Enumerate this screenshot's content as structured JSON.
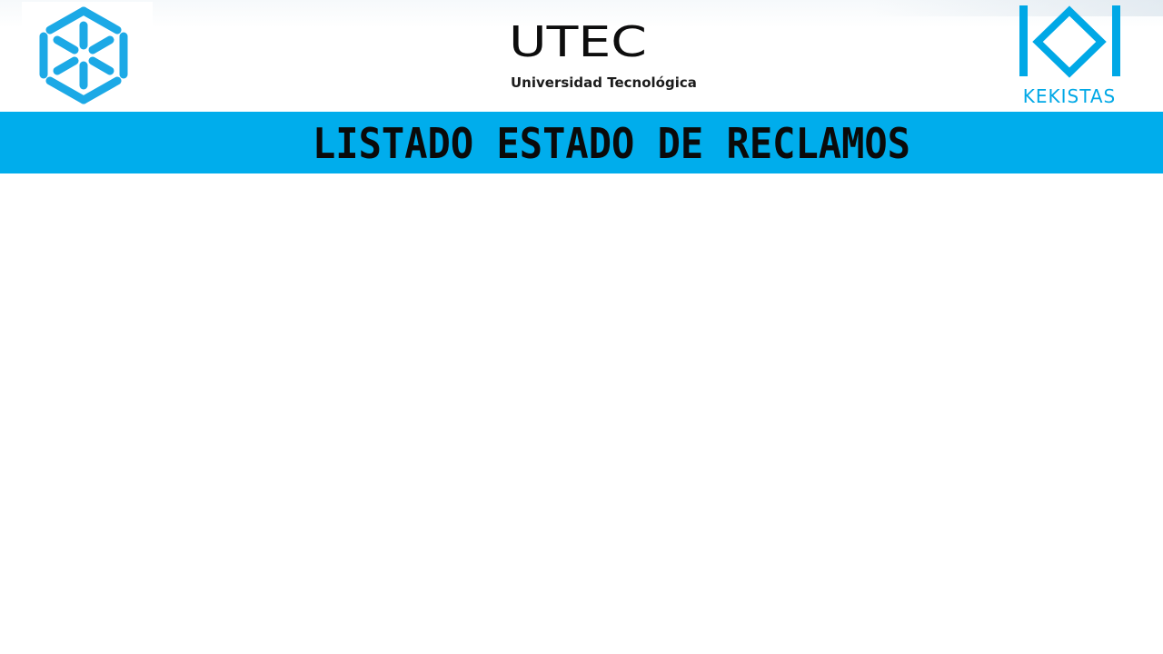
{
  "header": {
    "left_logo": {
      "icon": "hexagon-flower-logo-icon",
      "color": "#1ca9e6"
    },
    "center_logo": {
      "wordmark": "UTEC",
      "subtitle": "Universidad Tecnológica"
    },
    "right_logo": {
      "icon": "kekistas-logo-icon",
      "wordmark": "KEKISTAS",
      "color": "#00a8e6"
    }
  },
  "title_bar": {
    "title": "LISTADO ESTADO DE RECLAMOS",
    "background": "#00adec",
    "text_color": "#0a0a0a"
  }
}
